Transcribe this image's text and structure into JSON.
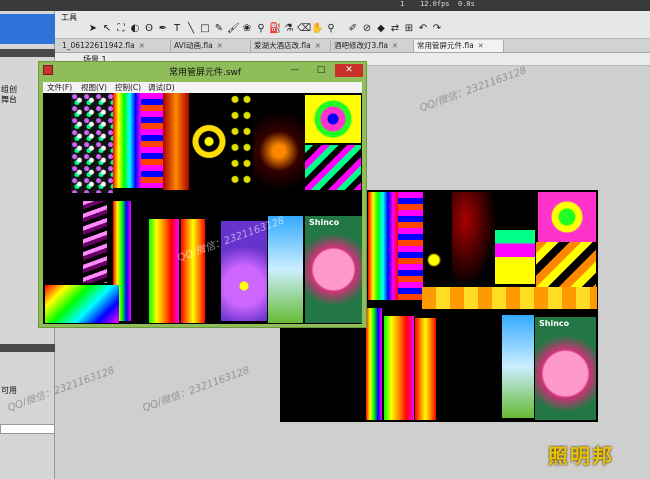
{
  "toolbar": {
    "title": "工具",
    "fps_left": "1",
    "fps_mid": "12.0fps",
    "fps_right": "0.0s",
    "tools": [
      {
        "icon": "arrow-icon",
        "glyph": "➤"
      },
      {
        "icon": "subselect-icon",
        "glyph": "↖"
      },
      {
        "icon": "free-transform-icon",
        "glyph": "⛶"
      },
      {
        "icon": "gradient-icon",
        "glyph": "◐"
      },
      {
        "icon": "lasso-icon",
        "glyph": "ʘ"
      },
      {
        "icon": "pen-icon",
        "glyph": "✒"
      },
      {
        "icon": "text-tool-icon",
        "glyph": "T"
      },
      {
        "icon": "line-tool-icon",
        "glyph": "╲"
      },
      {
        "icon": "rectangle-tool-icon",
        "glyph": "□"
      },
      {
        "icon": "pencil-icon",
        "glyph": "✎"
      },
      {
        "icon": "brush-icon",
        "glyph": "🖌"
      },
      {
        "icon": "deco-icon",
        "glyph": "❀"
      },
      {
        "icon": "bone-icon",
        "glyph": "⚲"
      },
      {
        "icon": "paint-bucket-icon",
        "glyph": "⛽"
      },
      {
        "icon": "eyedropper-icon",
        "glyph": "⚗"
      },
      {
        "icon": "eraser-icon",
        "glyph": "⌫"
      },
      {
        "icon": "hand-icon",
        "glyph": "✋"
      },
      {
        "icon": "zoom-icon",
        "glyph": "⚲"
      },
      {
        "icon": "stroke-color-icon",
        "glyph": "✐"
      },
      {
        "icon": "no-color-icon",
        "glyph": "⊘"
      },
      {
        "icon": "fill-color-icon",
        "glyph": "◆"
      },
      {
        "icon": "swap-colors-icon",
        "glyph": "⇄"
      },
      {
        "icon": "snap-icon",
        "glyph": "⊞"
      },
      {
        "icon": "undo-icon",
        "glyph": "↶"
      },
      {
        "icon": "redo-icon",
        "glyph": "↷"
      }
    ]
  },
  "tabs": [
    {
      "label": "1_06122611942.fla"
    },
    {
      "label": "AVI动画.fla"
    },
    {
      "label": "爱湖大酒店改.fla"
    },
    {
      "label": "酒吧修改灯3.fla"
    },
    {
      "label": "常用管屏元件.fla",
      "active": true
    }
  ],
  "scene": {
    "label": "场景 1"
  },
  "left_panel": {
    "label_1": "组创",
    "label_2": "舞台",
    "label_3": "可用"
  },
  "swf_window": {
    "title": "常用管屏元件.swf",
    "minimize": "—",
    "maximize": "□",
    "close": "✕",
    "menu": [
      "文件(F)",
      "视图(V)",
      "控制(C)",
      "调试(D)"
    ]
  },
  "watermark": {
    "text": "QQ/微信：2321163128"
  },
  "image_text": {
    "shinco": "Shinco"
  },
  "logo": {
    "text": "照明邦"
  },
  "colors": {
    "accent_blue": "#2f72d8",
    "window_green": "#8fbd5a",
    "close_red": "#c9302c",
    "logo_yellow": "#f2c400"
  }
}
